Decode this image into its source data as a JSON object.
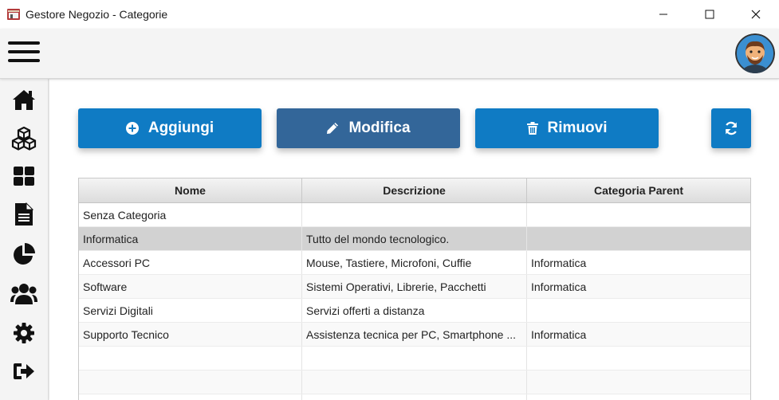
{
  "window": {
    "title": "Gestore Negozio - Categorie",
    "app_icon": "store-icon",
    "controls": [
      "minimize-icon",
      "maximize-icon",
      "close-icon"
    ]
  },
  "header": {
    "menu_icon": "hamburger-menu-icon",
    "avatar": "user-avatar"
  },
  "sidebar": {
    "items": [
      {
        "icon": "home-icon"
      },
      {
        "icon": "cubes-icon"
      },
      {
        "icon": "dashboard-grid-icon"
      },
      {
        "icon": "document-icon"
      },
      {
        "icon": "pie-chart-icon"
      },
      {
        "icon": "users-icon"
      },
      {
        "icon": "gear-icon"
      },
      {
        "icon": "logout-icon"
      }
    ]
  },
  "toolbar": {
    "add_label": "Aggiungi",
    "edit_label": "Modifica",
    "remove_label": "Rimuovi",
    "refresh_icon": "refresh-icon"
  },
  "table": {
    "columns": [
      "Nome",
      "Descrizione",
      "Categoria Parent"
    ],
    "rows": [
      [
        "Senza Categoria",
        "",
        ""
      ],
      [
        "Informatica",
        "Tutto del mondo tecnologico.",
        ""
      ],
      [
        "Accessori PC",
        "Mouse, Tastiere, Microfoni, Cuffie",
        "Informatica"
      ],
      [
        "Software",
        "Sistemi Operativi, Librerie, Pacchetti",
        "Informatica"
      ],
      [
        "Servizi Digitali",
        "Servizi offerti a distanza",
        ""
      ],
      [
        "Supporto Tecnico",
        "Assistenza tecnica per PC, Smartphone ...",
        "Informatica"
      ],
      [
        "",
        "",
        ""
      ],
      [
        "",
        "",
        ""
      ],
      [
        "",
        "",
        ""
      ]
    ],
    "selected_row": 2
  },
  "colors": {
    "primary_button": "#0f7bc4",
    "active_button": "#336699",
    "selected_row": "#d2d2d2"
  }
}
